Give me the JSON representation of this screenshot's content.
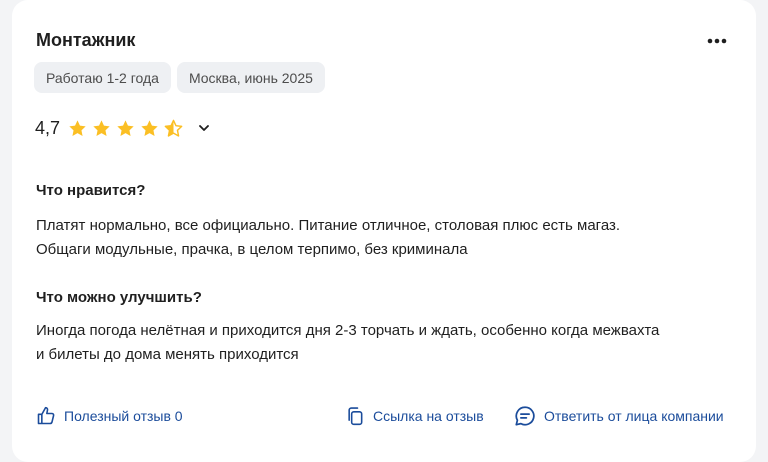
{
  "review": {
    "job_title": "Монтажник",
    "tags": [
      "Работаю 1-2 года",
      "Москва, июнь 2025"
    ],
    "rating": "4,7",
    "stars": 4.5,
    "pros_title": "Что нравится?",
    "pros_text_line1": "Платят нормально, все официально. Питание отличное, столовая плюс есть магаз.",
    "pros_text_line2": "Общаги модульные, прачка, в целом терпимо, без криминала",
    "cons_title": "Что можно улучшить?",
    "cons_text_line1": "Иногда погода нелётная и приходится дня 2-3 торчать и ждать, особенно когда межвахта",
    "cons_text_line2": "и билеты до дома менять приходится"
  },
  "actions": {
    "helpful_label": "Полезный отзыв 0",
    "link_label": "Ссылка на отзыв",
    "reply_label": "Ответить от лица компании"
  },
  "colors": {
    "star": "#fbbf24",
    "link": "#1b4c9b",
    "chip_bg": "#eef0f3"
  }
}
